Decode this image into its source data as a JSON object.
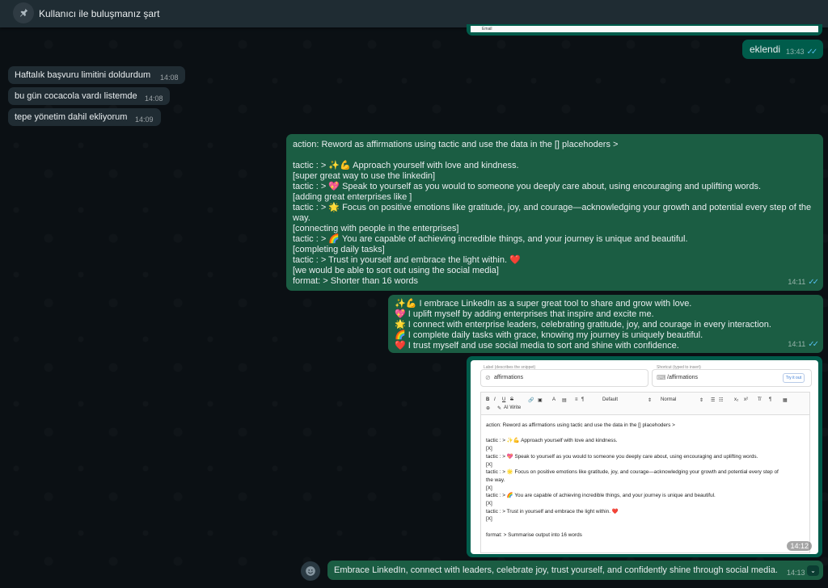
{
  "banner": {
    "text": "Kullanıcı ile buluşmanız şart"
  },
  "top_image": {
    "email_label": "Email"
  },
  "messages": {
    "eklendi": {
      "text": "eklendi",
      "time": "13:43"
    },
    "in1": {
      "text": "Haftalık başvuru limitini doldurdum",
      "time": "14:08"
    },
    "in2": {
      "text": "bu gün cocacola vardı listemde",
      "time": "14:08"
    },
    "in3": {
      "text": "tepe yönetim dahil ekliyorum",
      "time": "14:09"
    },
    "prompt": {
      "time": "14:11",
      "lines": [
        "action: Reword as affirmations using tactic and use the data in the [] placehoders >",
        "",
        "tactic : >  ✨💪 Approach yourself with love and kindness.",
        "[super great way to use the linkedin]",
        "tactic : > 💖 Speak to yourself as you would to someone you deeply care about, using encouraging and uplifting words.",
        "[adding great enterprises like ]",
        "tactic : > 🌟 Focus on positive emotions like gratitude, joy, and courage—acknowledging your growth and potential every step of the way.",
        "[connecting with people in the enterprises]",
        "tactic : > 🌈 You are capable of achieving incredible things, and your journey is unique and beautiful.",
        "[completing daily tasks]",
        "tactic : > Trust in yourself and embrace the light within. ❤️",
        "[we would be able to sort out using the social media]",
        "format: > Shorter than 16 words"
      ]
    },
    "affirmations": {
      "time": "14:11",
      "lines": [
        "✨💪 I embrace LinkedIn as a super great tool to share and grow with love.",
        "💖 I uplift myself by adding enterprises that inspire and excite me.",
        "🌟 I connect with enterprise leaders, celebrating gratitude, joy, and courage in every interaction.",
        "🌈 I complete daily tasks with grace, knowing my journey is uniquely beautiful.",
        "❤️ I trust myself and use social media to sort and shine with confidence."
      ]
    },
    "final": {
      "text": "Embrace LinkedIn, connect with leaders, celebrate joy, trust yourself, and confidently shine through social media.",
      "time": "14:13"
    }
  },
  "snippet": {
    "time": "14:12",
    "label_caption": "Label (describes the snippet)",
    "label_value": "affirmations",
    "shortcut_caption": "Shortcut (typed to insert)",
    "shortcut_value": "/affirmations",
    "try_button": "Try it out",
    "toolbar": {
      "bold": "B",
      "italic": "I",
      "underline": "U",
      "strike": "S",
      "font": "Default",
      "size": "Normal",
      "ai_write": "AI Write"
    },
    "editor_lines": [
      "action: Reword as affirmations using tactic and use the data in the [] placehoders >",
      "",
      "tactic : >  ✨💪 Approach yourself with love and kindness.",
      "[X]",
      "tactic : > 💖 Speak to yourself as you would to someone you deeply care about, using encouraging and uplifting words.",
      "[X]",
      "tactic : > 🌟 Focus on positive emotions like gratitude, joy, and courage—acknowledging your growth and potential every step of",
      "the way.",
      "[X]",
      "tactic : > 🌈 You are capable of achieving incredible things, and your journey is unique and beautiful.",
      "[X]",
      "tactic : > Trust in yourself and embrace the light within. ❤️",
      "[X]",
      "",
      "format: > Summarise output into 16 words"
    ]
  }
}
